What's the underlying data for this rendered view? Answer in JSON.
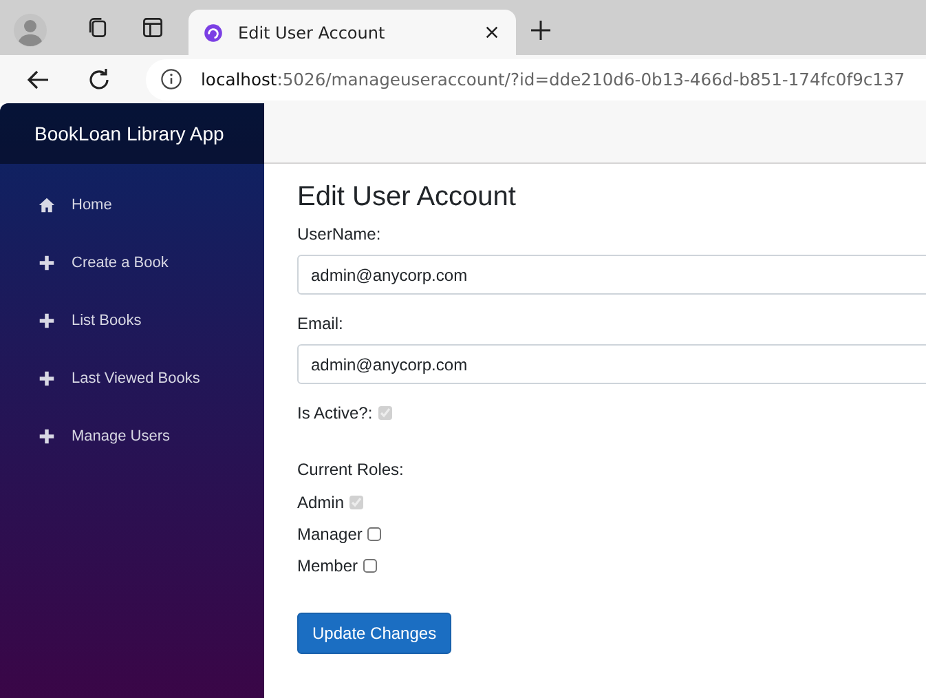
{
  "browser": {
    "tab": {
      "title": "Edit User Account"
    },
    "url": {
      "host": "localhost",
      "path": ":5026/manageuseraccount/?id=dde210d6-0b13-466d-b851-174fc0f9c137"
    }
  },
  "sidebar": {
    "brand": "BookLoan Library App",
    "items": [
      {
        "label": "Home",
        "kind": "home"
      },
      {
        "label": "Create a Book",
        "kind": "plus"
      },
      {
        "label": "List Books",
        "kind": "plus"
      },
      {
        "label": "Last Viewed Books",
        "kind": "plus"
      },
      {
        "label": "Manage Users",
        "kind": "plus"
      }
    ]
  },
  "form": {
    "title": "Edit User Account",
    "fields": [
      {
        "label": "UserName:",
        "value": "admin@anycorp.com"
      },
      {
        "label": "Email:",
        "value": "admin@anycorp.com"
      }
    ],
    "is_active": {
      "label": "Is Active?:",
      "checked": true
    },
    "roles_label": "Current Roles:",
    "roles": [
      {
        "label": "Admin",
        "checked": true
      },
      {
        "label": "Manager",
        "checked": false
      },
      {
        "label": "Member",
        "checked": false
      }
    ],
    "submit": "Update Changes"
  }
}
